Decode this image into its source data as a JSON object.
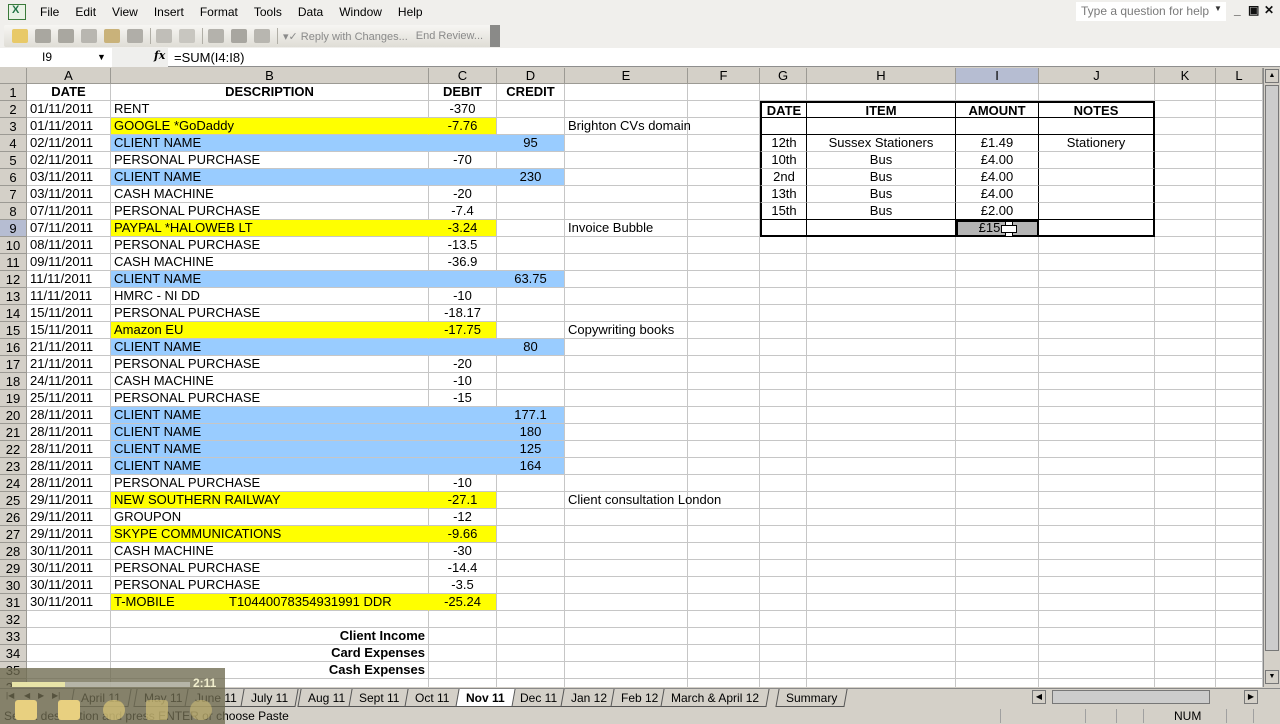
{
  "menubar": {
    "items": [
      "File",
      "Edit",
      "View",
      "Insert",
      "Format",
      "Tools",
      "Data",
      "Window",
      "Help"
    ],
    "underline": [
      "F",
      "E",
      "V",
      "I",
      "o",
      "T",
      "D",
      "W",
      "H"
    ],
    "help_placeholder": "Type a question for help"
  },
  "toolbar": {
    "reply_label": "Reply with Changes...",
    "end_review_label": "End Review..."
  },
  "formula_bar": {
    "name_box": "I9",
    "fx": "fx",
    "formula": "=SUM(I4:I8)"
  },
  "columns": [
    "A",
    "B",
    "C",
    "D",
    "E",
    "F",
    "G",
    "H",
    "I",
    "J",
    "K",
    "L"
  ],
  "selected_column": "I",
  "selected_row": 9,
  "headers": {
    "date": "DATE",
    "description": "DESCRIPTION",
    "debit": "DEBIT",
    "credit": "CREDIT"
  },
  "rows": [
    {
      "row": 2,
      "date": "01/11/2011",
      "desc": "RENT",
      "debit": "-370",
      "credit": "",
      "note": "",
      "color": ""
    },
    {
      "row": 3,
      "date": "01/11/2011",
      "desc": "GOOGLE *GoDaddy",
      "debit": "-7.76",
      "credit": "",
      "note": "Brighton CVs domain",
      "color": "yellow"
    },
    {
      "row": 4,
      "date": "02/11/2011",
      "desc": "CLIENT NAME",
      "debit": "",
      "credit": "95",
      "note": "",
      "color": "blue"
    },
    {
      "row": 5,
      "date": "02/11/2011",
      "desc": "PERSONAL PURCHASE",
      "debit": "-70",
      "credit": "",
      "note": "",
      "color": ""
    },
    {
      "row": 6,
      "date": "03/11/2011",
      "desc": "CLIENT NAME",
      "debit": "",
      "credit": "230",
      "note": "",
      "color": "blue"
    },
    {
      "row": 7,
      "date": "03/11/2011",
      "desc": "CASH MACHINE",
      "debit": "-20",
      "credit": "",
      "note": "",
      "color": ""
    },
    {
      "row": 8,
      "date": "07/11/2011",
      "desc": "PERSONAL PURCHASE",
      "debit": "-7.4",
      "credit": "",
      "note": "",
      "color": ""
    },
    {
      "row": 9,
      "date": "07/11/2011",
      "desc": "PAYPAL *HALOWEB LT",
      "debit": "-3.24",
      "credit": "",
      "note": "Invoice Bubble",
      "color": "yellow"
    },
    {
      "row": 10,
      "date": "08/11/2011",
      "desc": "PERSONAL PURCHASE",
      "debit": "-13.5",
      "credit": "",
      "note": "",
      "color": ""
    },
    {
      "row": 11,
      "date": "09/11/2011",
      "desc": "CASH MACHINE",
      "debit": "-36.9",
      "credit": "",
      "note": "",
      "color": ""
    },
    {
      "row": 12,
      "date": "11/11/2011",
      "desc": "CLIENT NAME",
      "debit": "",
      "credit": "63.75",
      "note": "",
      "color": "blue"
    },
    {
      "row": 13,
      "date": "11/11/2011",
      "desc": "HMRC - NI DD",
      "debit": "-10",
      "credit": "",
      "note": "",
      "color": ""
    },
    {
      "row": 14,
      "date": "15/11/2011",
      "desc": "PERSONAL PURCHASE",
      "debit": "-18.17",
      "credit": "",
      "note": "",
      "color": ""
    },
    {
      "row": 15,
      "date": "15/11/2011",
      "desc": "Amazon EU",
      "debit": "-17.75",
      "credit": "",
      "note": "Copywriting books",
      "color": "yellow"
    },
    {
      "row": 16,
      "date": "21/11/2011",
      "desc": "CLIENT NAME",
      "debit": "",
      "credit": "80",
      "note": "",
      "color": "blue"
    },
    {
      "row": 17,
      "date": "21/11/2011",
      "desc": "PERSONAL PURCHASE",
      "debit": "-20",
      "credit": "",
      "note": "",
      "color": ""
    },
    {
      "row": 18,
      "date": "24/11/2011",
      "desc": "CASH MACHINE",
      "debit": "-10",
      "credit": "",
      "note": "",
      "color": ""
    },
    {
      "row": 19,
      "date": "25/11/2011",
      "desc": "PERSONAL PURCHASE",
      "debit": "-15",
      "credit": "",
      "note": "",
      "color": ""
    },
    {
      "row": 20,
      "date": "28/11/2011",
      "desc": "CLIENT NAME",
      "debit": "",
      "credit": "177.1",
      "note": "",
      "color": "blue"
    },
    {
      "row": 21,
      "date": "28/11/2011",
      "desc": "CLIENT NAME",
      "debit": "",
      "credit": "180",
      "note": "",
      "color": "blue"
    },
    {
      "row": 22,
      "date": "28/11/2011",
      "desc": "CLIENT NAME",
      "debit": "",
      "credit": "125",
      "note": "",
      "color": "blue"
    },
    {
      "row": 23,
      "date": "28/11/2011",
      "desc": "CLIENT NAME",
      "debit": "",
      "credit": "164",
      "note": "",
      "color": "blue"
    },
    {
      "row": 24,
      "date": "28/11/2011",
      "desc": "PERSONAL PURCHASE",
      "debit": "-10",
      "credit": "",
      "note": "",
      "color": ""
    },
    {
      "row": 25,
      "date": "29/11/2011",
      "desc": "NEW SOUTHERN RAILWAY",
      "debit": "-27.1",
      "credit": "",
      "note": "Client consultation London",
      "color": "yellow"
    },
    {
      "row": 26,
      "date": "29/11/2011",
      "desc": "GROUPON",
      "debit": "-12",
      "credit": "",
      "note": "",
      "color": ""
    },
    {
      "row": 27,
      "date": "29/11/2011",
      "desc": "SKYPE COMMUNICATIONS",
      "debit": "-9.66",
      "credit": "",
      "note": "",
      "color": "yellow"
    },
    {
      "row": 28,
      "date": "30/11/2011",
      "desc": "CASH MACHINE",
      "debit": "-30",
      "credit": "",
      "note": "",
      "color": ""
    },
    {
      "row": 29,
      "date": "30/11/2011",
      "desc": "PERSONAL PURCHASE",
      "debit": "-14.4",
      "credit": "",
      "note": "",
      "color": ""
    },
    {
      "row": 30,
      "date": "30/11/2011",
      "desc": "PERSONAL PURCHASE",
      "debit": "-3.5",
      "credit": "",
      "note": "",
      "color": ""
    },
    {
      "row": 31,
      "date": "30/11/2011",
      "desc": "T-MOBILE",
      "desc2": "T10440078354931991 DDR",
      "debit": "-25.24",
      "credit": "",
      "note": "",
      "color": "yellow"
    }
  ],
  "summary_labels": [
    {
      "row": 33,
      "label": "Client Income"
    },
    {
      "row": 34,
      "label": "Card Expenses"
    },
    {
      "row": 35,
      "label": "Cash Expenses"
    }
  ],
  "cash_table": {
    "headers": [
      "DATE",
      "ITEM",
      "AMOUNT",
      "NOTES"
    ],
    "rows": [
      {
        "date": "",
        "item": "",
        "amount": "",
        "notes": ""
      },
      {
        "date": "12th",
        "item": "Sussex Stationers",
        "amount": "£1.49",
        "notes": "Stationery"
      },
      {
        "date": "10th",
        "item": "Bus",
        "amount": "£4.00",
        "notes": ""
      },
      {
        "date": "2nd",
        "item": "Bus",
        "amount": "£4.00",
        "notes": ""
      },
      {
        "date": "13th",
        "item": "Bus",
        "amount": "£4.00",
        "notes": ""
      },
      {
        "date": "15th",
        "item": "Bus",
        "amount": "£2.00",
        "notes": ""
      },
      {
        "date": "",
        "item": "",
        "amount": "£15",
        "notes": ""
      }
    ]
  },
  "sheet_tabs": [
    "April 11",
    "May 11",
    "June 11",
    "July 11",
    "Aug 11",
    "Sept 11",
    "Oct 11",
    "Nov 11",
    "Dec 11",
    "Jan 12",
    "Feb 12",
    "March & April 12",
    "Summary"
  ],
  "active_tab": "Nov 11",
  "status_bar": {
    "message": "Select destination and press ENTER or choose Paste",
    "num_indicator": "NUM"
  },
  "video_overlay": {
    "time": "2:11",
    "progress": 0.3
  },
  "colors": {
    "yellow_highlight": "#ffff00",
    "blue_highlight": "#99ccff",
    "selected_header": "#b6bdd2"
  }
}
